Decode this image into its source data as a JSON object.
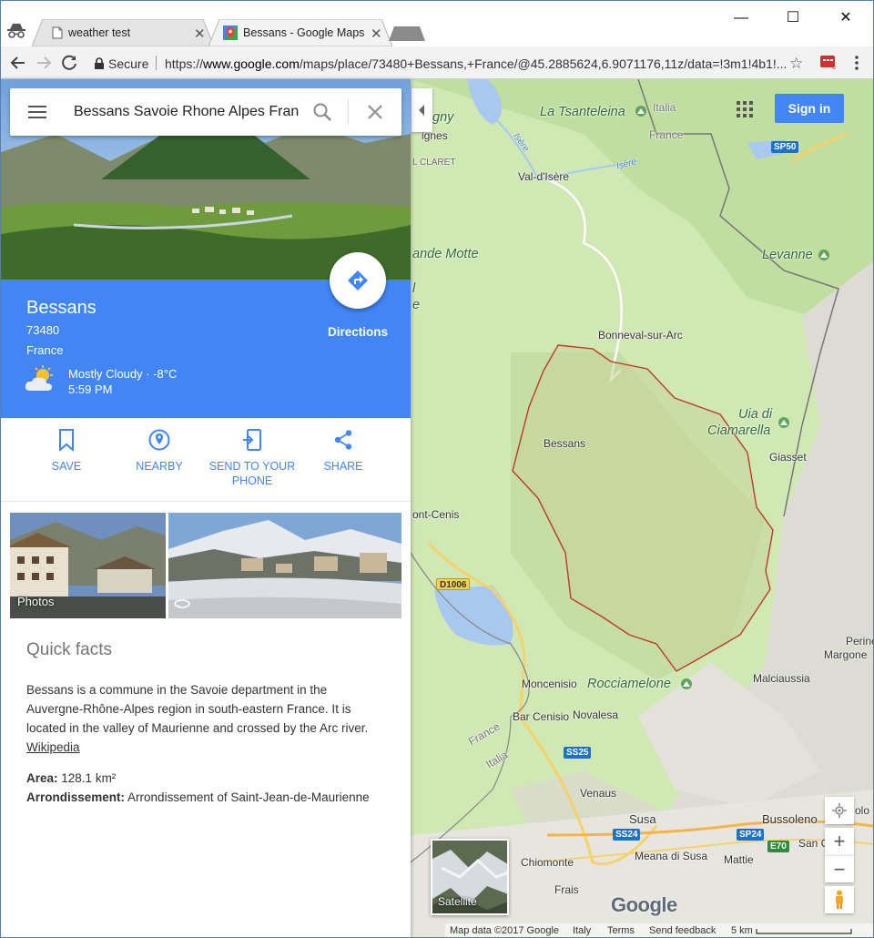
{
  "browser": {
    "tabs": [
      {
        "title": "weather test",
        "active": false
      },
      {
        "title": "Bessans - Google Maps",
        "active": true
      }
    ],
    "close_glyph": "✕",
    "window_controls": {
      "minimize": "—",
      "maximize": "☐",
      "close": "✕"
    },
    "secure_label": "Secure",
    "url_prefix": "https://",
    "url_host": "www.google.com",
    "url_path": "/maps/place/73480+Bessans,+France/@45.2885624,6.9071176,11z/data=!3m1!4b1!...",
    "extension_badge": "6",
    "star_glyph": "☆"
  },
  "search": {
    "query": "Bessans Savoie Rhone Alpes France",
    "icons": [
      "menu-icon",
      "search-icon",
      "close-icon"
    ]
  },
  "place": {
    "name": "Bessans",
    "postal_code": "73480",
    "country": "France",
    "weather": {
      "condition": "Mostly Cloudy · -8°C",
      "time": "5:59 PM",
      "icon": "partly-cloudy-icon"
    },
    "directions_label": "Directions"
  },
  "actions": [
    {
      "label": "SAVE",
      "icon": "bookmark-icon"
    },
    {
      "label": "NEARBY",
      "icon": "location-pin-icon"
    },
    {
      "label": "SEND TO YOUR PHONE",
      "icon": "send-to-phone-icon"
    },
    {
      "label": "SHARE",
      "icon": "share-icon"
    }
  ],
  "photos": {
    "label": "Photos"
  },
  "quick_facts": {
    "title": "Quick facts",
    "description": "Bessans is a commune in the Savoie department in the Auvergne-Rhône-Alpes region in south-eastern France. It is located in the valley of Maurienne and crossed by the Arc river.",
    "source_link": "Wikipedia",
    "area_label": "Area:",
    "area_value": "128.1 km²",
    "arrondissement_label": "Arrondissement:",
    "arrondissement_value": "Arrondissement of Saint-Jean-de-Maurienne"
  },
  "map": {
    "sign_in": "Sign in",
    "satellite_label": "Satellite",
    "google_logo": "Google",
    "zoom_in": "+",
    "zoom_out": "−",
    "labels": {
      "tsanteleina": "La Tsanteleina",
      "italia_top": "Italia",
      "france_top": "France",
      "gny": "gny",
      "ignes": "ignes",
      "claret": "L CLARET",
      "val_disere": "Val-d'Isère",
      "isere1": "Isère",
      "isere2": "Isère",
      "grande_motte": "ande Motte",
      "levanne": "Levanne",
      "bonneval": "Bonneval-sur-Arc",
      "uia": "Uia di",
      "ciamarella": "Ciamarella",
      "giasset": "Giasset",
      "bessans": "Bessans",
      "mont_cenis": "ont-Cenis",
      "perine": "Perine",
      "margone": "Margone",
      "moncenisio": "Moncenisio",
      "rocciamelone": "Rocciamelone",
      "malciaussia": "Malciaussia",
      "bar_cenisio": "Bar Cenisio",
      "novalesa": "Novalesa",
      "france_bottom": "France",
      "italia_bottom": "Italia",
      "venaus": "Venaus",
      "susa": "Susa",
      "bussoleno": "Bussoleno",
      "solo": "olo",
      "san_c": "San C",
      "chiomonte": "Chiomonte",
      "meana": "Meana di Susa",
      "mattie": "Mattie",
      "frais": "Frais",
      "l_letter": "l",
      "e_letter": "e"
    },
    "road_shields": {
      "sp50": "SP50",
      "d1006": "D1006",
      "ss25": "SS25",
      "ss24a": "SS24",
      "sp24": "SP24",
      "e70": "E70",
      "ss24b": "SS24"
    },
    "footer": {
      "map_data": "Map data ©2017 Google",
      "region": "Italy",
      "terms": "Terms",
      "feedback": "Send feedback",
      "scale": "5 km"
    }
  },
  "colors": {
    "accent_blue": "#4285f4",
    "boundary_red": "#c0392b",
    "map_green": "#cfe8b4",
    "road_yellow": "#f7d26b"
  }
}
